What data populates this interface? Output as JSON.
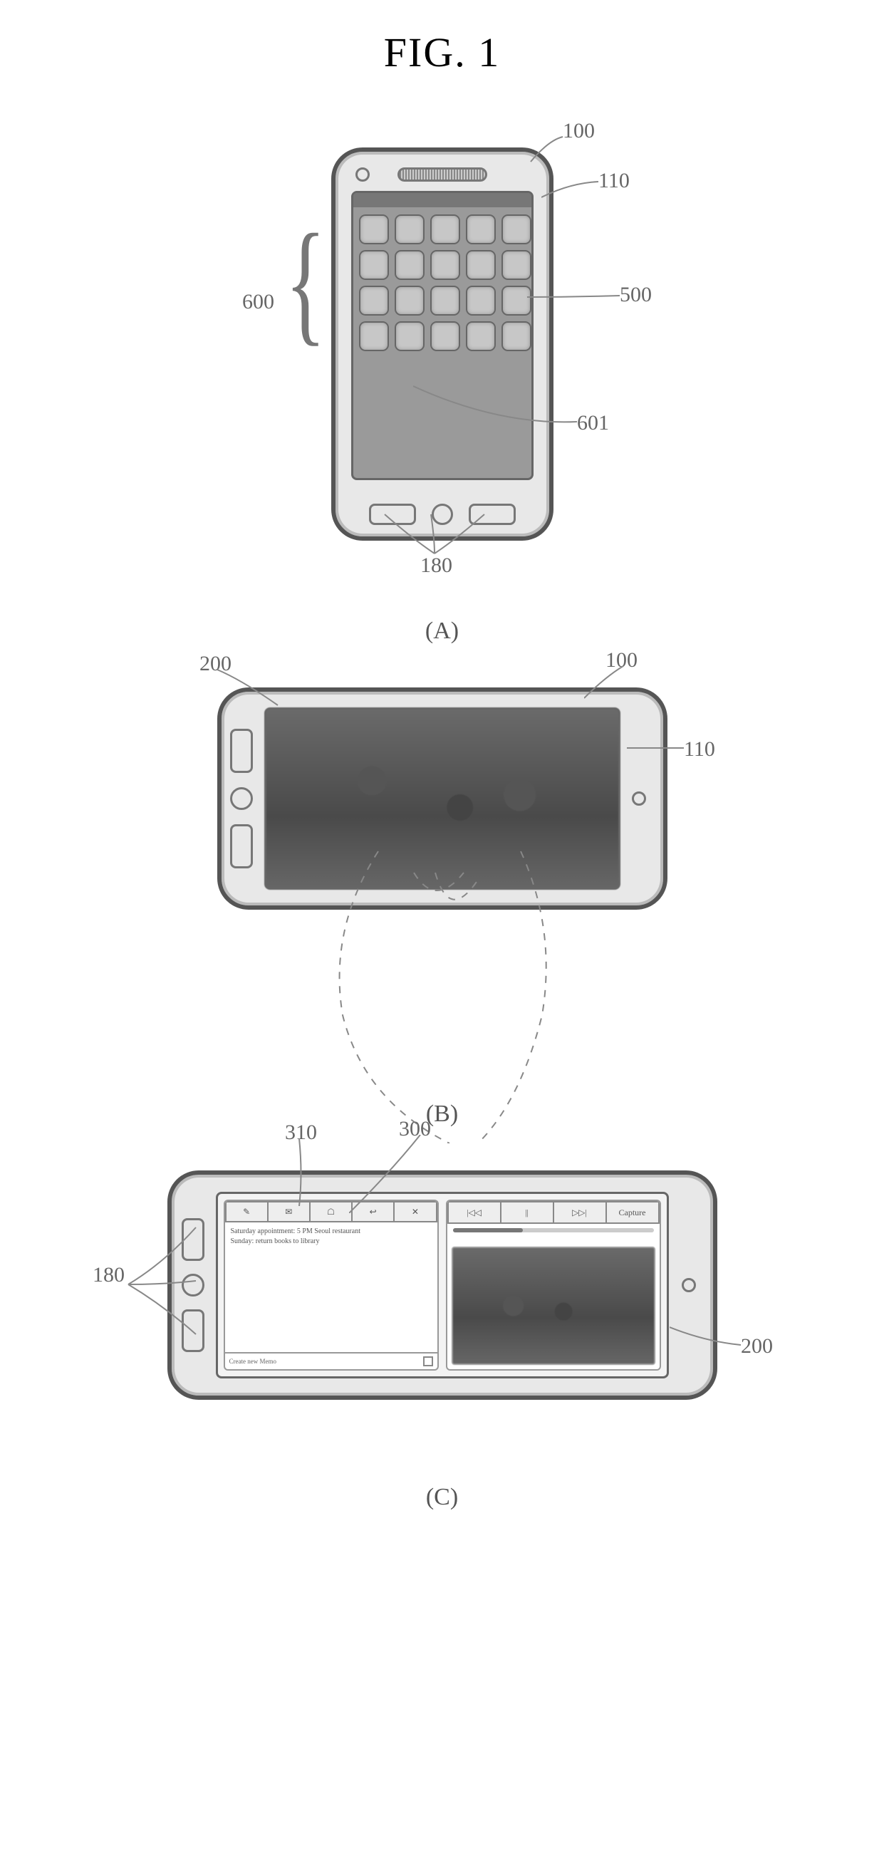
{
  "figure": {
    "title": "FIG. 1",
    "panels": {
      "a": "(A)",
      "b": "(B)",
      "c": "(C)"
    }
  },
  "refs": {
    "r100": "100",
    "r110": "110",
    "r500": "500",
    "r600": "600",
    "r601": "601",
    "r180": "180",
    "r200": "200",
    "r300": "300",
    "r310": "310"
  },
  "panelC": {
    "memo": {
      "toolbar_icons": [
        "✎",
        "✉",
        "☖",
        "↩",
        "✕"
      ],
      "line1": "Saturday appointment: 5 PM Seoul restaurant",
      "line2": "Sunday: return books to library",
      "footer_label": "Create new Memo"
    },
    "player": {
      "controls": [
        "|◁◁",
        "||",
        "▷▷|",
        "Capture"
      ]
    }
  }
}
